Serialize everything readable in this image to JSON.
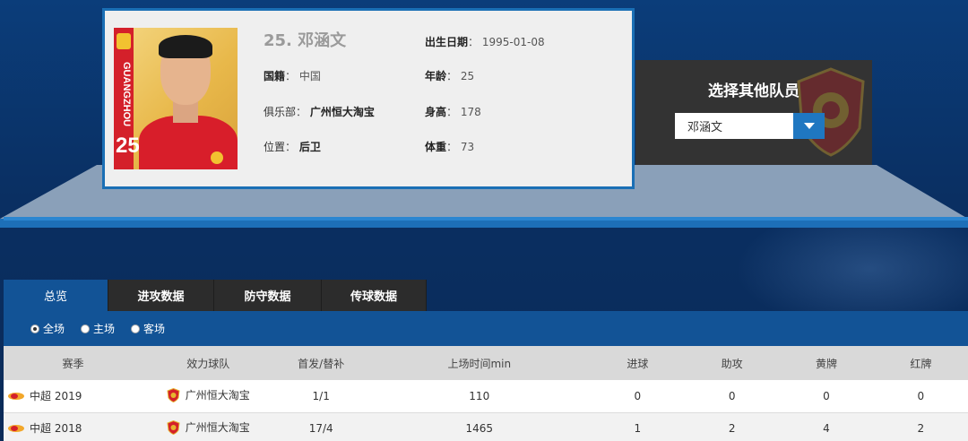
{
  "player": {
    "name_line": "25. 邓涵文",
    "jersey_number": "25",
    "club_strip_text": "GUANGZHOU",
    "fields": {
      "nationality_label": "国籍",
      "nationality_value": "中国",
      "club_label": "俱乐部",
      "club_value": "广州恒大淘宝",
      "position_label": "位置",
      "position_value": "后卫",
      "birth_label": "出生日期",
      "birth_value": "1995-01-08",
      "age_label": "年龄",
      "age_value": "25",
      "height_label": "身高",
      "height_value": "178",
      "weight_label": "体重",
      "weight_value": "73"
    }
  },
  "selector": {
    "title": "选择其他队员",
    "selected_value": "邓涵文"
  },
  "tabs": [
    {
      "label": "总览",
      "active": true
    },
    {
      "label": "进攻数据",
      "active": false
    },
    {
      "label": "防守数据",
      "active": false
    },
    {
      "label": "传球数据",
      "active": false
    }
  ],
  "filters": [
    {
      "label": "全场",
      "checked": true
    },
    {
      "label": "主场",
      "checked": false
    },
    {
      "label": "客场",
      "checked": false
    }
  ],
  "table": {
    "headers": [
      "赛季",
      "效力球队",
      "首发/替补",
      "上场时间min",
      "进球",
      "助攻",
      "黄牌",
      "红牌"
    ],
    "rows": [
      {
        "season": "中超 2019",
        "team": "广州恒大淘宝",
        "starts": "1/1",
        "minutes": "110",
        "goals": "0",
        "assists": "0",
        "yellow": "0",
        "red": "0"
      },
      {
        "season": "中超 2018",
        "team": "广州恒大淘宝",
        "starts": "17/4",
        "minutes": "1465",
        "goals": "1",
        "assists": "2",
        "yellow": "4",
        "red": "2"
      }
    ]
  },
  "colors": {
    "accent_blue": "#125396",
    "dark_panel": "#333333",
    "club_red": "#d4202a",
    "crest_gold": "#f2c230"
  },
  "icons": {
    "dropdown": "chevron-down-icon",
    "league": "csl-logo-icon",
    "team": "guangzhou-crest-icon"
  }
}
